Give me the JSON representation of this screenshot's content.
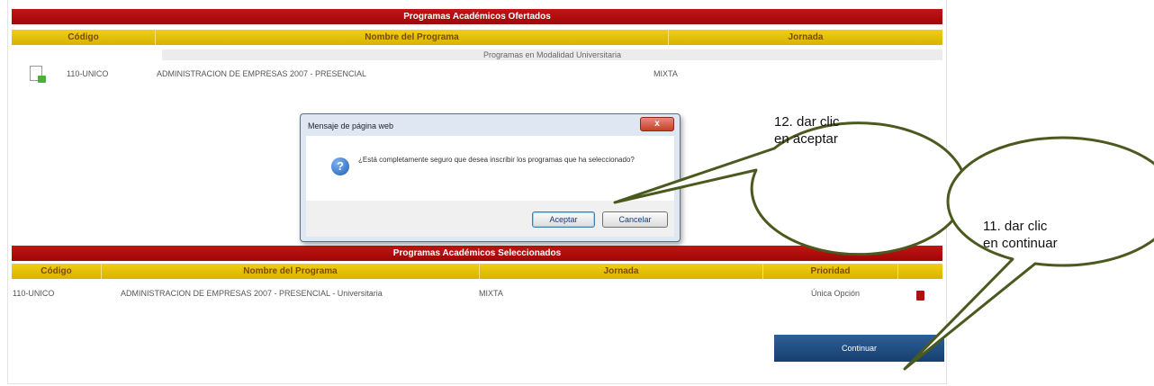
{
  "offered": {
    "title": "Programas Académicos Ofertados",
    "columns": [
      "Código",
      "Nombre del Programa",
      "Jornada"
    ],
    "group_label": "Programas en Modalidad Universitaria",
    "rows": [
      {
        "code": "110-UNICO",
        "name": "ADMINISTRACION DE EMPRESAS 2007 - PRESENCIAL",
        "schedule": "MIXTA",
        "icon": "document-lock-icon"
      }
    ]
  },
  "dialog": {
    "title": "Mensaje de página web",
    "close_label": "x",
    "icon": "question-icon",
    "message": "¿Está completamente seguro que desea inscribir los programas que ha seleccionado?",
    "accept_label": "Aceptar",
    "cancel_label": "Cancelar"
  },
  "selected": {
    "title": "Programas Académicos Seleccionados",
    "columns": [
      "Código",
      "Nombre del Programa",
      "Jornada",
      "Prioridad"
    ],
    "rows": [
      {
        "code": "110-UNICO",
        "name": "ADMINISTRACION DE EMPRESAS 2007 - PRESENCIAL - Universitaria",
        "schedule": "MIXTA",
        "priority": "Única Opción",
        "icon": "delete-icon"
      }
    ]
  },
  "continue_label": "Continuar",
  "callouts": {
    "accept": {
      "line1": "12.  dar clic",
      "line2": "en aceptar"
    },
    "continue": {
      "line1": "11.  dar clic",
      "line2": "en continuar"
    }
  },
  "colors": {
    "title_bar": "#b40c0c",
    "header_bar": "#e3c200",
    "continue_button": "#1f4a7e",
    "callout_stroke": "#4a5a1e"
  }
}
